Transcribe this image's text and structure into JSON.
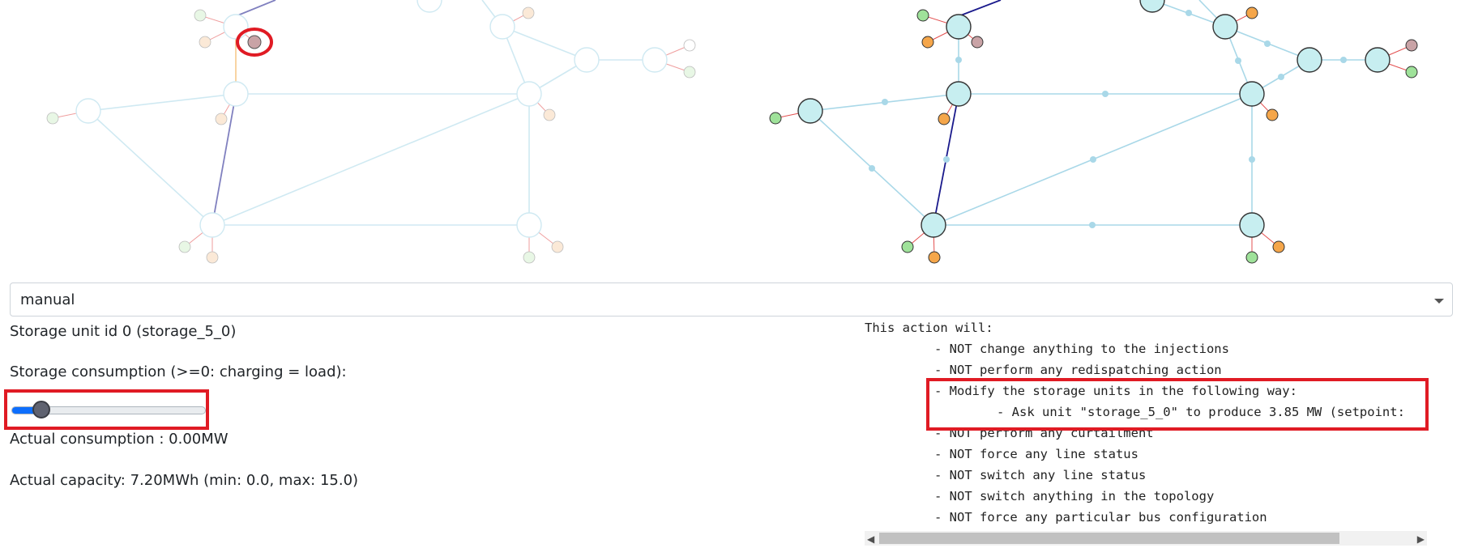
{
  "controls": {
    "mode_select_value": "manual",
    "storage_title": "Storage unit id 0 (storage_5_0)",
    "consumption_label": "Storage consumption (>=0: charging = load):",
    "slider_value_fraction": 0.15,
    "actual_consumption": "Actual consumption : 0.00MW",
    "actual_capacity": "Actual capacity: 7.20MWh (min: 0.0, max: 15.0)"
  },
  "action_text": {
    "header": "This action will:",
    "lines": [
      "- NOT change anything to the injections",
      "- NOT perform any redispatching action",
      "- Modify the storage units in the following way:",
      "- Ask unit \"storage_5_0\" to produce 3.85 MW (setpoint:",
      "- NOT perform any curtailment",
      "- NOT force any line status",
      "- NOT switch any line status",
      "- NOT switch anything in the topology",
      "- NOT force any particular bus configuration"
    ]
  },
  "colors": {
    "substation_fill": "#c7eef0",
    "line_color": "#a9d8e8",
    "overflow_line": "#1a1a8c",
    "element_link": "#e35050",
    "load_fill": "#f5a64a",
    "gen_fill": "#9fe29a",
    "storage_fill": "#c9a3a6",
    "highlight": "#e01b24",
    "slider_fill": "#0d6efd"
  }
}
